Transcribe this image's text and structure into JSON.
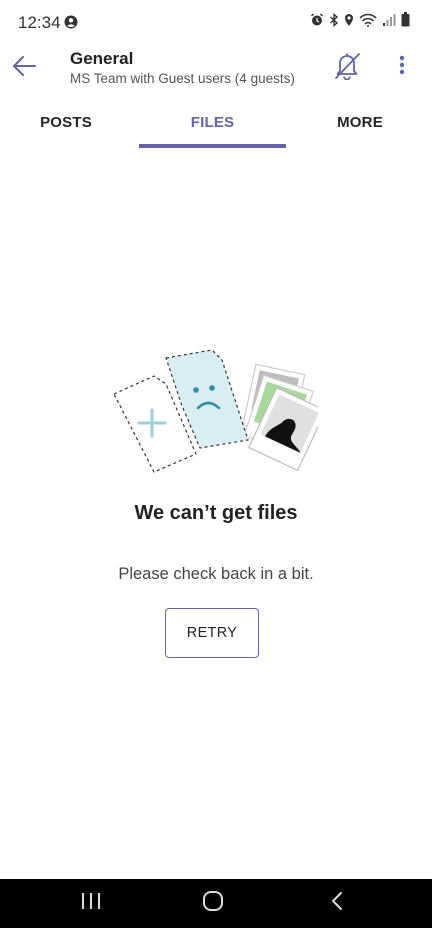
{
  "status_bar": {
    "time": "12:34",
    "left_icon": "account-circle-icon",
    "right_icons": [
      "alarm-icon",
      "bluetooth-icon",
      "location-icon",
      "wifi-icon",
      "signal-icon",
      "battery-icon"
    ]
  },
  "header": {
    "back_icon": "arrow-left-icon",
    "title": "General",
    "subtitle": "MS Team with Guest users (4 guests)",
    "mute_icon": "bell-off-icon",
    "more_icon": "more-vertical-icon"
  },
  "tabs": [
    {
      "label": "POSTS",
      "selected": false
    },
    {
      "label": "FILES",
      "selected": true
    },
    {
      "label": "MORE",
      "selected": false
    }
  ],
  "empty_state": {
    "illustration": "files-error-illustration",
    "title": "We can’t get files",
    "subtitle": "Please check back in a bit.",
    "retry_label": "RETRY"
  },
  "nav_bar": {
    "recents_icon": "recents-icon",
    "home_icon": "home-icon",
    "back_icon": "back-chevron-icon"
  },
  "colors": {
    "accent": "#6264a7",
    "text_primary": "#222222",
    "text_secondary": "#555555",
    "nav_bar": "#000000"
  }
}
